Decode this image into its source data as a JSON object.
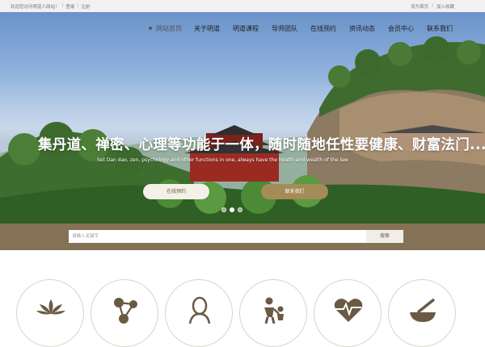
{
  "topbar": {
    "welcome": "欢迎您访问明道人网站！",
    "login": "登录",
    "register": "注册",
    "set_home": "设为首页",
    "add_favorite": "加入收藏"
  },
  "nav": {
    "items": [
      "网站首页",
      "关于明道",
      "明道课程",
      "导师团队",
      "在线预约",
      "资讯动态",
      "会员中心",
      "联系我们"
    ]
  },
  "hero": {
    "headline": "集丹道、禅密、心理等功能于一体，随时随地任性要健康、财富法门...",
    "subline": "Set Dan dao, zen, psychology and other functions in one, always have the health and wealth of the law",
    "button_online": "在线预约",
    "button_contact": "联系我们",
    "slides": 3,
    "active_slide": 1
  },
  "search": {
    "placeholder": "请输入关键字",
    "button": "搜索"
  },
  "services": {
    "icons": [
      "lotus-icon",
      "molecule-icon",
      "mentor-icon",
      "parent-child-icon",
      "heartbeat-icon",
      "mortar-pestle-icon"
    ]
  },
  "colors": {
    "accent_gold": "#a58b58",
    "search_band": "#857256"
  }
}
